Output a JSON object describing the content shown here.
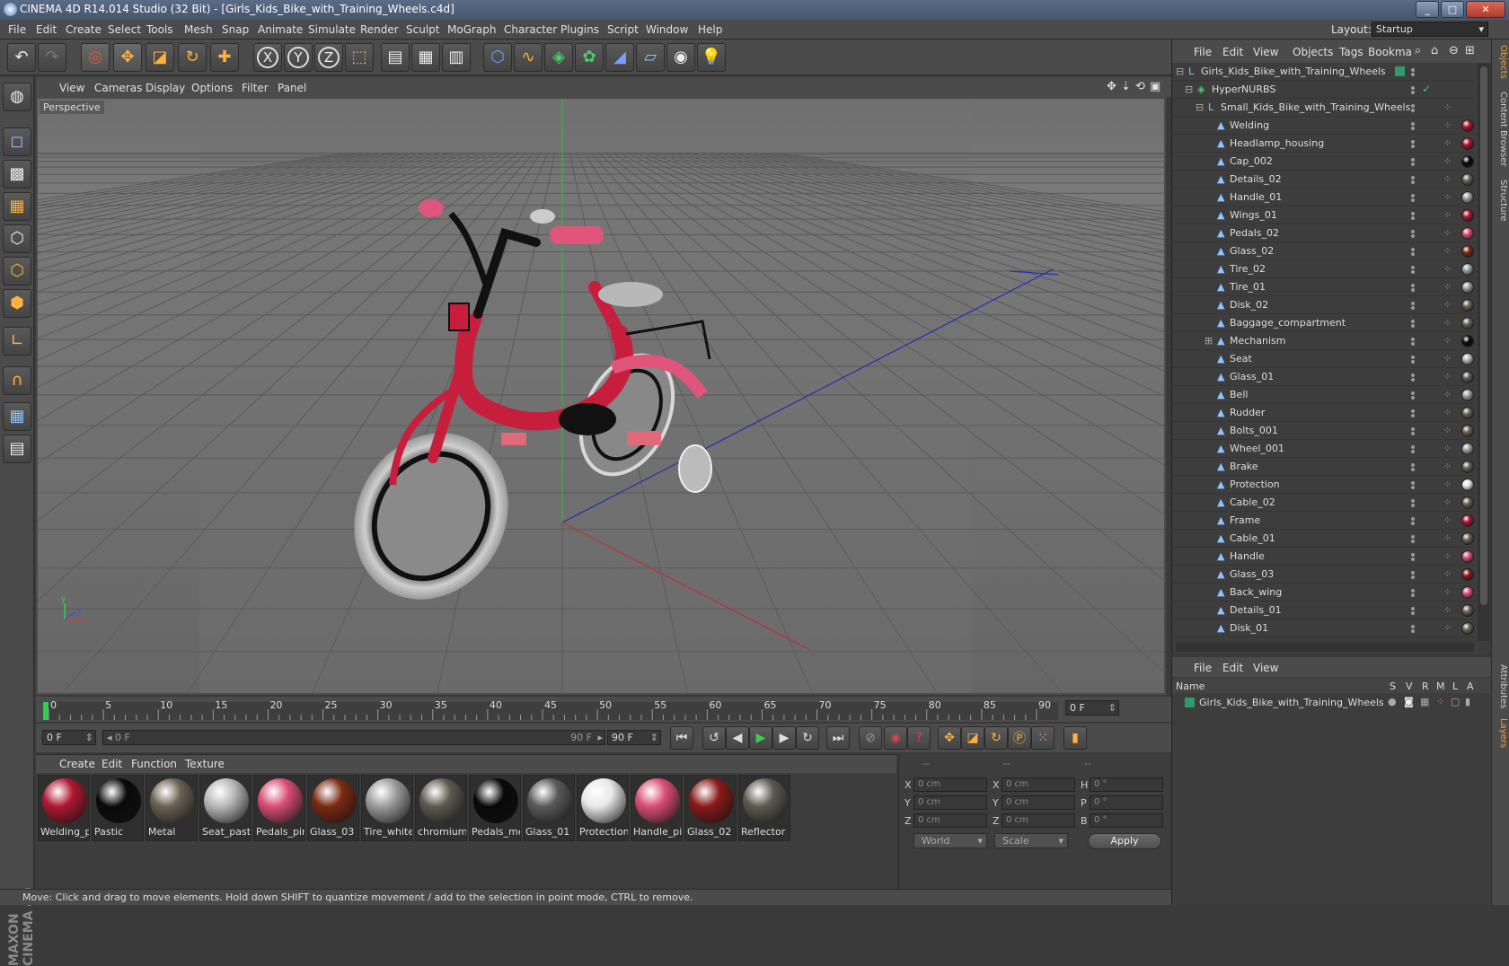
{
  "window": {
    "title": "CINEMA 4D R14.014 Studio (32 Bit) - [Girls_Kids_Bike_with_Training_Wheels.c4d]",
    "min": "_",
    "max": "□",
    "close": "✕"
  },
  "menubar": {
    "items": [
      "File",
      "Edit",
      "Create",
      "Select",
      "Tools",
      "Mesh",
      "Snap",
      "Animate",
      "Simulate",
      "Render",
      "Sculpt",
      "MoGraph",
      "Character",
      "Plugins",
      "Script",
      "Window",
      "Help"
    ],
    "layout_label": "Layout:",
    "layout_value": "Startup"
  },
  "toolbar": {
    "icons": [
      "undo-icon",
      "redo-icon",
      "live-select-icon",
      "move-icon",
      "scale-icon",
      "rotate-icon",
      "move-plus-icon",
      "x-axis-icon",
      "y-axis-icon",
      "z-axis-icon",
      "world-coord-icon",
      "render-view-icon",
      "render-picture-viewer-icon",
      "render-settings-icon",
      "cube-icon",
      "spline-icon",
      "nurbs-icon",
      "array-icon",
      "deformer-icon",
      "floor-icon",
      "camera-icon",
      "light-icon"
    ],
    "axis_labels": [
      "X",
      "Y",
      "Z"
    ]
  },
  "viewport": {
    "menu": [
      "View",
      "Cameras",
      "Display",
      "Options",
      "Filter",
      "Panel"
    ],
    "label": "Perspective",
    "axis_x": "x",
    "axis_y": "y",
    "axis_z": "z"
  },
  "timeline": {
    "ticks": [
      "0",
      "5",
      "10",
      "15",
      "20",
      "25",
      "30",
      "35",
      "40",
      "45",
      "50",
      "55",
      "60",
      "65",
      "70",
      "75",
      "80",
      "85",
      "90"
    ],
    "current_frame": "0 F",
    "start_field": "0 F",
    "range_start": "0 F",
    "range_end": "90 F",
    "end_field": "90 F"
  },
  "material_manager": {
    "menu": [
      "Create",
      "Edit",
      "Function",
      "Texture"
    ],
    "materials": [
      {
        "label": "Welding_p",
        "color": "#b0172f"
      },
      {
        "label": "Pastic",
        "color": "#0a0a0a"
      },
      {
        "label": "Metal",
        "color": "#6b6152"
      },
      {
        "label": "Seat_pastic",
        "color": "#b8b8b8"
      },
      {
        "label": "Pedals_pin",
        "color": "#d84d72"
      },
      {
        "label": "Glass_03",
        "color": "#7a2a12"
      },
      {
        "label": "Tire_white",
        "color": "#9c9c9c"
      },
      {
        "label": "chromium",
        "color": "#5d5a50"
      },
      {
        "label": "Pedals_met",
        "color": "#080808"
      },
      {
        "label": "Glass_01",
        "color": "#5a5a5a"
      },
      {
        "label": "Protection",
        "color": "#e8e8e8"
      },
      {
        "label": "Handle_pir",
        "color": "#d84d72"
      },
      {
        "label": "Glass_02",
        "color": "#8a1a1a"
      },
      {
        "label": "Reflector",
        "color": "#5d5a50"
      }
    ]
  },
  "coordinates": {
    "headers": [
      "--",
      "--",
      "--"
    ],
    "rows": [
      {
        "a": "X",
        "av": "0 cm",
        "b": "X",
        "bv": "0 cm",
        "c": "H",
        "cv": "0 °"
      },
      {
        "a": "Y",
        "av": "0 cm",
        "b": "Y",
        "bv": "0 cm",
        "c": "P",
        "cv": "0 °"
      },
      {
        "a": "Z",
        "av": "0 cm",
        "b": "Z",
        "bv": "0 cm",
        "c": "B",
        "cv": "0 °"
      }
    ],
    "world": "World",
    "scale": "Scale",
    "apply": "Apply"
  },
  "status": "Move: Click and drag to move elements. Hold down SHIFT to quantize movement / add to the selection in point mode, CTRL to remove.",
  "object_manager": {
    "menu": [
      "File",
      "Edit",
      "View",
      "Objects",
      "Tags",
      "Bookma"
    ],
    "root": "Girls_Kids_Bike_with_Training_Wheels",
    "nurbs": "HyperNURBS",
    "group": "Small_Kids_Bike_with_Training_Wheels",
    "objects": [
      {
        "name": "Welding",
        "tag": "#b0172f"
      },
      {
        "name": "Headlamp_housing",
        "tag": "#b0172f"
      },
      {
        "name": "Cap_002",
        "tag": "#0a0a0a"
      },
      {
        "name": "Details_02",
        "tag": "#6b6152"
      },
      {
        "name": "Handle_01",
        "tag": "#9c9c9c"
      },
      {
        "name": "Wings_01",
        "tag": "#b0172f"
      },
      {
        "name": "Pedals_02",
        "tag": "#d84d72"
      },
      {
        "name": "Glass_02",
        "tag": "#7a2a12"
      },
      {
        "name": "Tire_02",
        "tag": "#9c9c9c"
      },
      {
        "name": "Tire_01",
        "tag": "#9c9c9c"
      },
      {
        "name": "Disk_02",
        "tag": "#6b6152"
      },
      {
        "name": "Baggage_compartment",
        "tag": "#6b6152"
      },
      {
        "name": "Mechanism",
        "tag": "#0a0a0a"
      },
      {
        "name": "Seat",
        "tag": "#b8b8b8"
      },
      {
        "name": "Glass_01",
        "tag": "#5a5a5a"
      },
      {
        "name": "Bell",
        "tag": "#9c9c9c"
      },
      {
        "name": "Rudder",
        "tag": "#6b6152"
      },
      {
        "name": "Bolts_001",
        "tag": "#6b6152"
      },
      {
        "name": "Wheel_001",
        "tag": "#9c9c9c"
      },
      {
        "name": "Brake",
        "tag": "#6b6152"
      },
      {
        "name": "Protection",
        "tag": "#e8e8e8"
      },
      {
        "name": "Cable_02",
        "tag": "#6b6152"
      },
      {
        "name": "Frame",
        "tag": "#b0172f"
      },
      {
        "name": "Cable_01",
        "tag": "#6b6152"
      },
      {
        "name": "Handle",
        "tag": "#d84d72"
      },
      {
        "name": "Glass_03",
        "tag": "#8a1a1a"
      },
      {
        "name": "Back_wing",
        "tag": "#d84d72"
      },
      {
        "name": "Details_01",
        "tag": "#6b6152"
      },
      {
        "name": "Disk_01",
        "tag": "#6b6152"
      }
    ]
  },
  "layer_manager": {
    "menu": [
      "File",
      "Edit",
      "View"
    ],
    "header": {
      "name": "Name",
      "cols": [
        "S",
        "V",
        "R",
        "M",
        "L",
        "A"
      ]
    },
    "row": "Girls_Kids_Bike_with_Training_Wheels"
  },
  "right_tabs": [
    "Objects",
    "Content Browser",
    "Structure",
    "Attributes",
    "Layers"
  ],
  "brand": "MAXON CINEMA 4D",
  "colors": {
    "accent": "#f0a030",
    "layer_green": "#2f9a6e"
  }
}
